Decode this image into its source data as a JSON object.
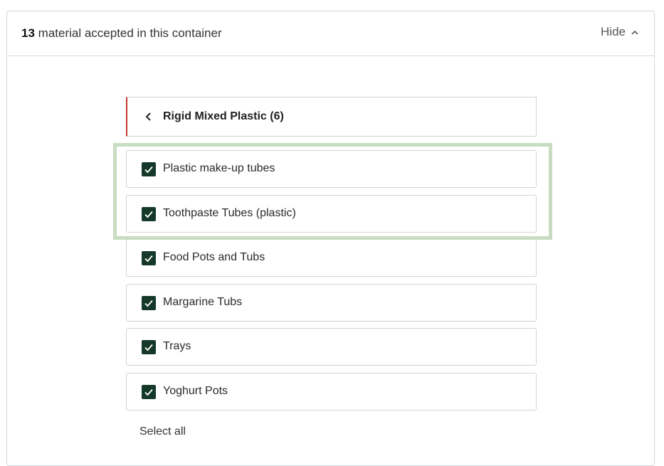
{
  "header": {
    "count": "13",
    "text": "material accepted in this container",
    "hide_label": "Hide",
    "caret_icon": "chevron-up-icon"
  },
  "category": {
    "title": "Rigid Mixed Plastic (6)",
    "back_icon": "chevron-left-icon",
    "accent_color": "#c0392b"
  },
  "items": [
    {
      "label": "Plastic make-up tubes",
      "checked": true
    },
    {
      "label": "Toothpaste Tubes (plastic)",
      "checked": true
    },
    {
      "label": "Food Pots and Tubs",
      "checked": true
    },
    {
      "label": "Margarine Tubs",
      "checked": true
    },
    {
      "label": "Trays",
      "checked": true
    },
    {
      "label": "Yoghurt Pots",
      "checked": true
    }
  ],
  "select_all_label": "Select all",
  "colors": {
    "checkbox": "#14392a",
    "highlight": "#c8dcc2"
  }
}
